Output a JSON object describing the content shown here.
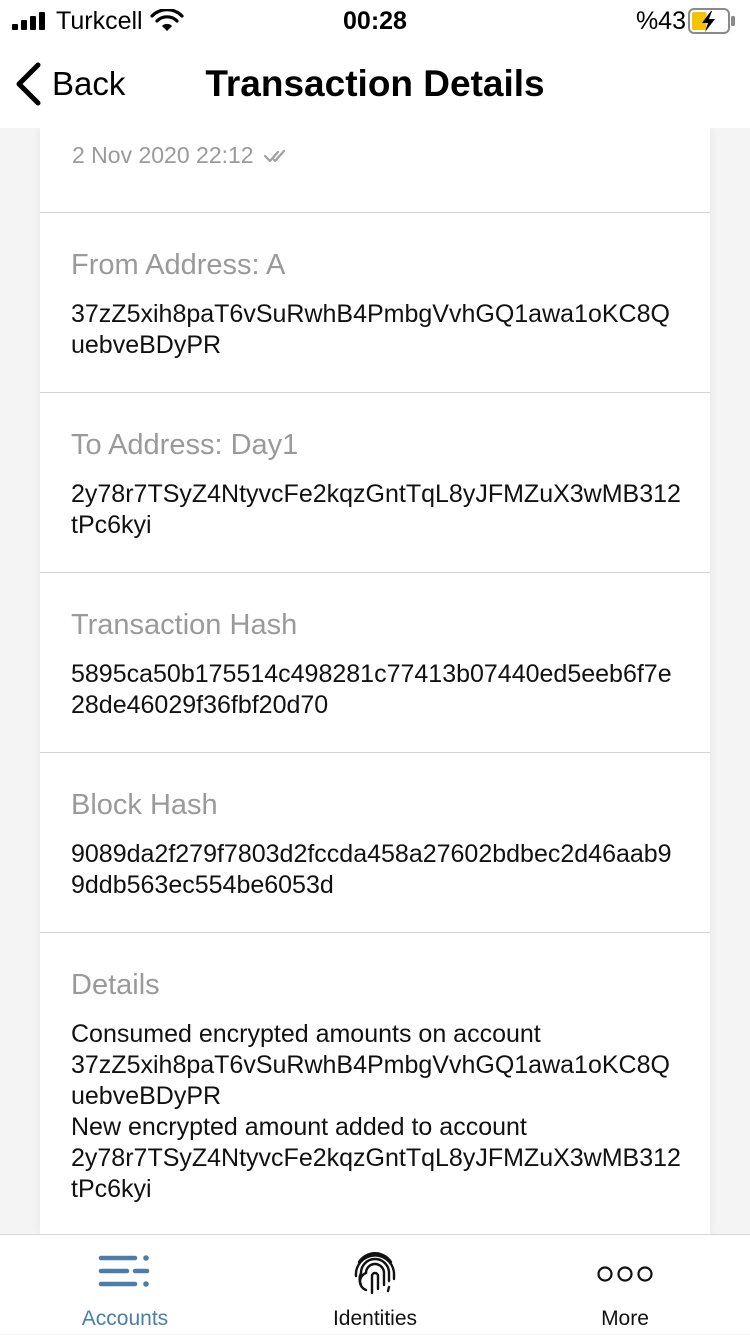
{
  "status_bar": {
    "carrier": "Turkcell",
    "time": "00:28",
    "battery_percent": "%43",
    "battery_level": 0.43,
    "icons": [
      "signal-icon",
      "wifi-icon",
      "battery-charging-icon"
    ]
  },
  "nav": {
    "back_label": "Back",
    "title": "Transaction Details"
  },
  "transaction": {
    "date": "2 Nov 2020 22:12",
    "status_icon": "double-check-icon"
  },
  "sections": [
    {
      "label": "From Address: A",
      "value": "37zZ5xih8paT6vSuRwhB4PmbgVvhGQ1awa1oKC8QuebveBDyPR"
    },
    {
      "label": "To Address: Day1",
      "value": "2y78r7TSyZ4NtyvcFe2kqzGntTqL8yJFMZuX3wMB312tPc6kyi"
    },
    {
      "label": "Transaction Hash",
      "value": "5895ca50b175514c498281c77413b07440ed5eeb6f7e28de46029f36fbf20d70"
    },
    {
      "label": "Block Hash",
      "value": "9089da2f279f7803d2fccda458a27602bdbec2d46aab99ddb563ec554be6053d"
    }
  ],
  "details": {
    "label": "Details",
    "lines": [
      "Consumed encrypted amounts on account",
      "37zZ5xih8paT6vSuRwhB4PmbgVvhGQ1awa1oKC8QuebveBDyPR",
      "New encrypted amount added to account",
      "2y78r7TSyZ4NtyvcFe2kqzGntTqL8yJFMZuX3wMB312tPc6kyi"
    ]
  },
  "tabs": [
    {
      "label": "Accounts",
      "icon": "accounts-list-icon",
      "active": true
    },
    {
      "label": "Identities",
      "icon": "fingerprint-icon",
      "active": false
    },
    {
      "label": "More",
      "icon": "more-dots-icon",
      "active": false
    }
  ],
  "colors": {
    "accent": "#4a7ea8",
    "label_gray": "#9a9a9a",
    "divider": "#d4d4d4",
    "background": "#f4f4f4",
    "battery_charging": "#f5c400"
  }
}
